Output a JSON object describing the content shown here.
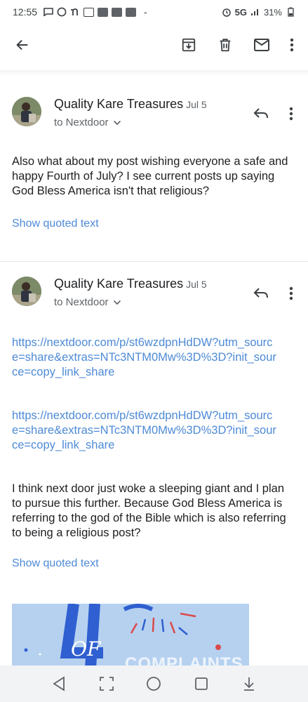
{
  "status_bar": {
    "time": "12:55",
    "network": "5G",
    "battery": "31%",
    "dash": "-"
  },
  "toolbar": {
    "back_icon": "arrow-left-icon",
    "archive_icon": "archive-icon",
    "delete_icon": "trash-icon",
    "unread_icon": "mail-icon",
    "more_icon": "more-vert-icon"
  },
  "messages": [
    {
      "sender": "Quality Kare Treasures",
      "date": "Jul 5",
      "recipient": "to Nextdoor",
      "body": "Also what about my post wishing everyone a safe and happy Fourth of July? I see current posts up saying God Bless America isn't that religious?",
      "show_quoted": "Show quoted text"
    },
    {
      "sender": "Quality Kare Treasures",
      "date": "Jul 5",
      "recipient": "to Nextdoor",
      "link1": "https://nextdoor.com/p/st6wzdpnHdDW?utm_source=share&extras=NTc3NTM0Mw%3D%3D?init_source=copy_link_share",
      "link2": "https://nextdoor.com/p/st6wzdpnHdDW?utm_source=share&extras=NTc3NTM0Mw%3D%3D?init_source=copy_link_share",
      "body": "I think next door just woke a sleeping giant and I plan to pursue this further. Because God Bless America is referring to the god of the Bible which is also referring to being a religious post?",
      "show_quoted": "Show quoted text"
    }
  ],
  "attachment": {
    "image_text": "OF",
    "watermark": "COMPLAINTS"
  },
  "colors": {
    "link": "#4d8ad6",
    "nav_bg": "#f1f3f4",
    "image_bg": "#b6d1f0"
  }
}
